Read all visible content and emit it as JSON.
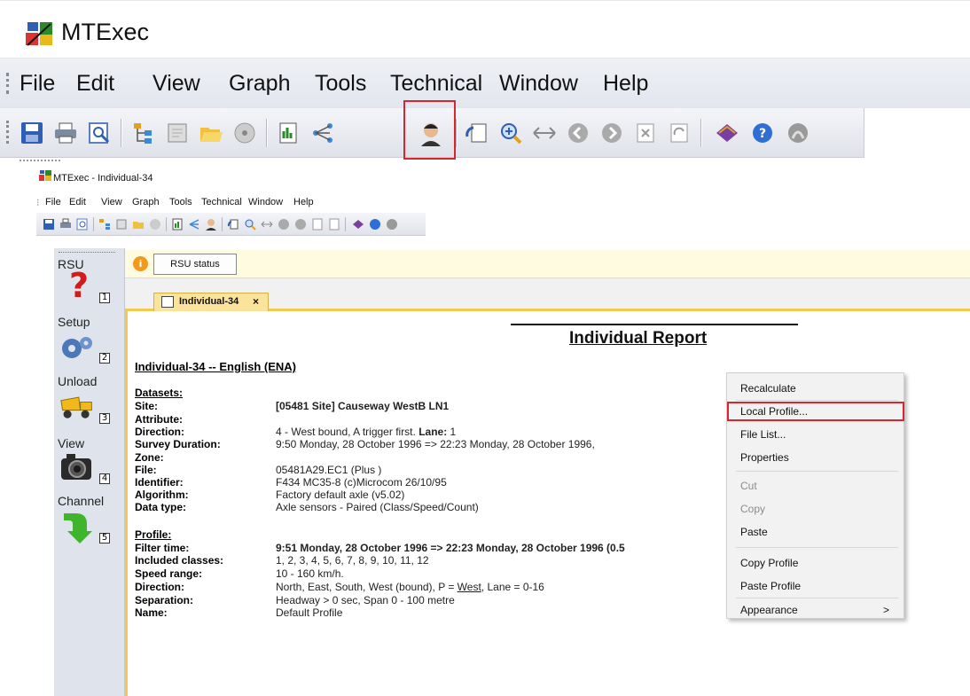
{
  "zoom": {
    "app_title": "MTExec",
    "menu": [
      "File",
      "Edit",
      "View",
      "Graph",
      "Tools",
      "Technical",
      "Window",
      "Help"
    ],
    "highlighted_tool": "local-profile-tool-icon"
  },
  "window": {
    "title": "MTExec - Individual-34",
    "menu": [
      "File",
      "Edit",
      "View",
      "Graph",
      "Tools",
      "Technical",
      "Window",
      "Help"
    ]
  },
  "sidebar": {
    "items": [
      {
        "label": "RSU",
        "num": "1",
        "icon": "question-mark-icon"
      },
      {
        "label": "Setup",
        "num": "2",
        "icon": "gears-icon"
      },
      {
        "label": "Unload",
        "num": "3",
        "icon": "dump-truck-icon"
      },
      {
        "label": "View",
        "num": "4",
        "icon": "camera-icon"
      },
      {
        "label": "Channel",
        "num": "5",
        "icon": "green-arrow-icon"
      }
    ]
  },
  "rsu_status": {
    "button": "RSU status"
  },
  "tab": {
    "label": "Individual-34",
    "close": "×"
  },
  "report": {
    "title": "Individual Report",
    "heading": "Individual-34 -- English (ENA)",
    "datasets_title": "Datasets:",
    "datasets": [
      {
        "key": "Site:",
        "value": "[05481 Site] Causeway WestB LN1",
        "bold": true
      },
      {
        "key": "Attribute:",
        "value": ""
      },
      {
        "key": "Direction:",
        "value": "4 - West bound, A trigger first. ",
        "extra_bold": "Lane:",
        "extra": " 1"
      },
      {
        "key": "Survey Duration:",
        "value": "9:50 Monday, 28 October 1996 => 22:23 Monday, 28 October 1996,"
      },
      {
        "key": "Zone:",
        "value": ""
      },
      {
        "key": "File:",
        "value": "05481A29.EC1 (Plus )"
      },
      {
        "key": "Identifier:",
        "value": "F434 MC35-8 (c)Microcom 26/10/95"
      },
      {
        "key": "Algorithm:",
        "value": "Factory default axle (v5.02)"
      },
      {
        "key": "Data type:",
        "value": "Axle sensors - Paired (Class/Speed/Count)"
      }
    ],
    "profile_title": "Profile:",
    "profile": [
      {
        "key": "Filter time:",
        "value": "9:51 Monday, 28 October 1996 => 22:23 Monday, 28 October 1996 (0.5",
        "bold": true
      },
      {
        "key": "Included classes:",
        "value": "1, 2, 3, 4, 5, 6, 7, 8, 9, 10, 11, 12"
      },
      {
        "key": "Speed range:",
        "value": "10 - 160 km/h."
      },
      {
        "key": "Direction:",
        "value": "North, East, South, West (bound), P = ",
        "underline": "West",
        "extra": ", Lane = 0-16"
      },
      {
        "key": "Separation:",
        "value": "Headway > 0 sec, Span 0 - 100 metre"
      },
      {
        "key": "Name:",
        "value": "Default Profile"
      }
    ]
  },
  "context_menu": {
    "items": [
      {
        "label": "Recalculate",
        "disabled": false
      },
      {
        "label": "Local Profile...",
        "disabled": false,
        "highlighted": true
      },
      {
        "label": "File List...",
        "disabled": false
      },
      {
        "label": "Properties",
        "disabled": false
      },
      {
        "label": "Cut",
        "disabled": true
      },
      {
        "label": "Copy",
        "disabled": true
      },
      {
        "label": "Paste",
        "disabled": false
      },
      {
        "label": "Copy Profile",
        "disabled": false
      },
      {
        "label": "Paste Profile",
        "disabled": false
      },
      {
        "label": "Appearance",
        "disabled": false,
        "submenu": ">"
      }
    ]
  },
  "colors": {
    "highlight": "#d8262f",
    "tab": "#fce39b",
    "status_bar": "#fffbe0",
    "sidebar": "#dfe4ec"
  }
}
